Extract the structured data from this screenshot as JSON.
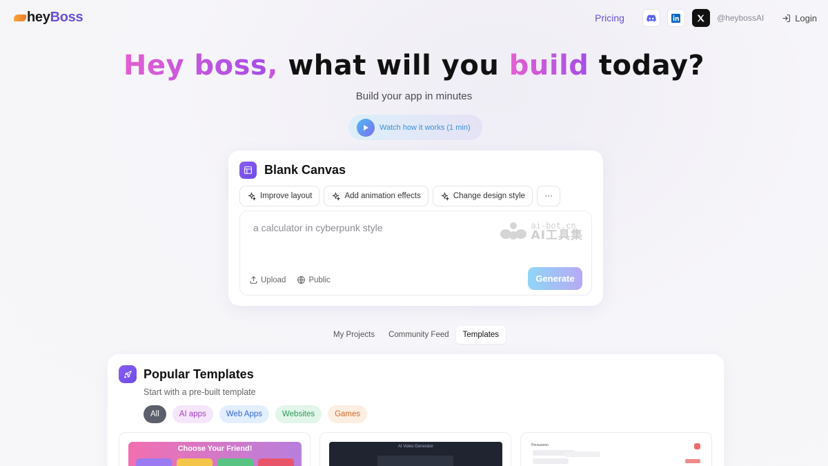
{
  "header": {
    "logo": {
      "prefix": "hey",
      "suffix": "Boss"
    },
    "pricing": "Pricing",
    "social": [
      "discord-icon",
      "linkedin-icon",
      "x-icon"
    ],
    "handle": "@heybossAI",
    "login": "Login"
  },
  "hero": {
    "title_part1": "Hey boss",
    "title_comma": ",",
    "title_part2": " what will you ",
    "title_part3": "build",
    "title_part4": " today?",
    "subtitle": "Build your app in minutes",
    "watch_label": "Watch how it works (1 min)"
  },
  "canvas": {
    "title": "Blank Canvas",
    "chips": [
      "Improve layout",
      "Add animation effects",
      "Change design style"
    ],
    "more": "···",
    "prompt_placeholder": "a calculator in cyberpunk style",
    "watermark_line1": "ai-bot.cn",
    "watermark_line2": "AI工具集",
    "upload": "Upload",
    "visibility": "Public",
    "generate": "Generate"
  },
  "tabs": [
    {
      "label": "My Projects",
      "active": false
    },
    {
      "label": "Community Feed",
      "active": false
    },
    {
      "label": "Templates",
      "active": true
    }
  ],
  "templates": {
    "title": "Popular Templates",
    "subtitle": "Start with a pre-built template",
    "filters": [
      "All",
      "AI apps",
      "Web Apps",
      "Websites",
      "Games"
    ],
    "selected_filter": "All",
    "thumbs": [
      {
        "title": "Choose Your Friend!"
      },
      {
        "title": "AI Video Generator"
      },
      {
        "title": "Persuasion"
      }
    ]
  },
  "colors": {
    "brand": "#6a4fd8",
    "hero_gradient_start": "#e35fd2",
    "hero_gradient_end": "#a54ee8",
    "generate_start": "#8fd6f5",
    "generate_end": "#b7a9f4"
  }
}
